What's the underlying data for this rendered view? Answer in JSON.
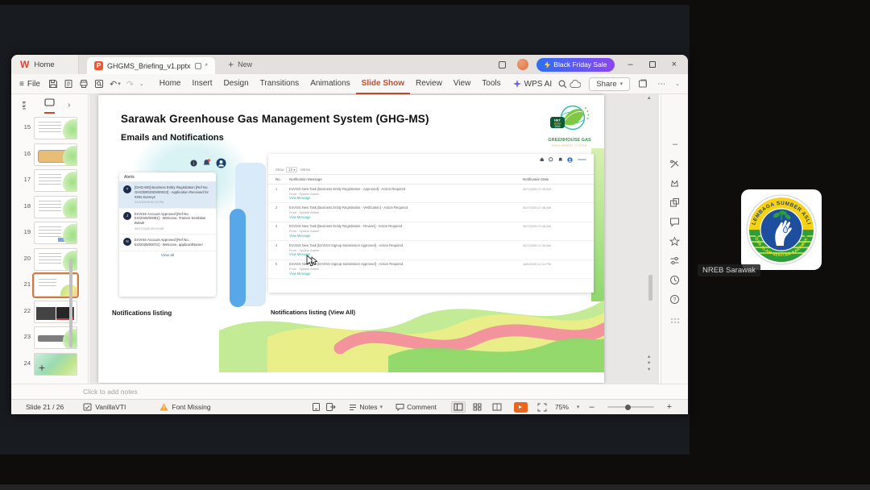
{
  "chrome": {
    "home_tab": "Home",
    "doc_tab": "GHGMS_Briefing_v1.pptx",
    "new_tab": "New",
    "promo": "Black Friday Sale",
    "file_menu": "File",
    "menus": [
      {
        "label": "Home",
        "cls": ""
      },
      {
        "label": "Insert",
        "cls": ""
      },
      {
        "label": "Design",
        "cls": ""
      },
      {
        "label": "Transitions",
        "cls": ""
      },
      {
        "label": "Animations",
        "cls": ""
      },
      {
        "label": "Slide Show",
        "cls": "active"
      },
      {
        "label": "Review",
        "cls": ""
      },
      {
        "label": "View",
        "cls": ""
      },
      {
        "label": "Tools",
        "cls": ""
      }
    ],
    "wps_ai": "WPS AI",
    "share": "Share"
  },
  "glyphs": {
    "wps_logo": "W",
    "doc_icon": "P",
    "asterisk": "*",
    "plus": "+",
    "menu": "≡",
    "undo": "↶",
    "redo": "↷",
    "caret_down": "▾",
    "chevron_down": "⌄",
    "chevron_right": "›",
    "more": "⋯",
    "minimize": "–",
    "close": "×",
    "scroll_up": "▴",
    "scroll_down": "▾",
    "minus": "–"
  },
  "sidebar": {
    "slides": [
      {
        "num": "15",
        "cls": "v-lines"
      },
      {
        "num": "16",
        "cls": "v-orange"
      },
      {
        "num": "17",
        "cls": "v-lines"
      },
      {
        "num": "18",
        "cls": "v-lines"
      },
      {
        "num": "19",
        "cls": "v-lines2"
      },
      {
        "num": "20",
        "cls": "v-lines"
      },
      {
        "num": "21",
        "cls": "v-current"
      },
      {
        "num": "22",
        "cls": "v-dark"
      },
      {
        "num": "23",
        "cls": "v-bar"
      },
      {
        "num": "24",
        "cls": "v-waves"
      }
    ]
  },
  "slide": {
    "title": "Sarawak Greenhouse Gas Management System (GHG-MS)",
    "subtitle": "Emails and Notifications",
    "logo": {
      "badge_line1": "NET",
      "badge_line2": "ZERO",
      "badge_line3": "2050",
      "name": "GREENHOUSE GAS",
      "tagline": "MANAGEMENT SYSTEM"
    },
    "alerts": {
      "header": "Alerts",
      "view_all": "View all",
      "items": [
        {
          "avatar": "T",
          "text": "[GHG-MS] Business Entity Registration [Ref No. GHG/BR/2025/00023] - Application Received for KNN Surveys",
          "date": "21/10/2025 02:19 PM",
          "highlight": "hl"
        },
        {
          "avatar": "J",
          "text": "EnVISS Account Approved [Ref No. ES/2025/00081] - Welcome, Trainee Sembilan Belad!",
          "date": "30/07/2025 09:09 AM",
          "highlight": ""
        },
        {
          "avatar": "N",
          "text": "EnVISS Account Approved [Ref No. ES/2025/00072] - Welcome, applicantName!",
          "date": "",
          "highlight": ""
        }
      ]
    },
    "table": {
      "show_prefix": "Show",
      "show_value": "10",
      "show_suffix": "entries",
      "col_no": "No.",
      "col_message": "Notification Message",
      "col_date": "Notification Date",
      "rows": [
        {
          "no": "1",
          "message": "EnVISS New Task [Business Entity Registration - Approved] - Action Required",
          "from": "From : System Admin",
          "link": "View Message",
          "date": "30/7/2025 07:49 AM"
        },
        {
          "no": "2",
          "message": "EnVISS New Task [Business Entity Registration - Verification] - Action Required",
          "from": "From : System Admin",
          "link": "View Message",
          "date": "30/7/2025 07:48 AM"
        },
        {
          "no": "3",
          "message": "EnVISS New Task [Business Entity Registration - Review] - Action Required",
          "from": "From : System Admin",
          "link": "View Message",
          "date": "30/7/2025 07:46 AM"
        },
        {
          "no": "4",
          "message": "EnVISS New Task [EnVISS Signup Submission Approved] - Action Required",
          "from": "From : System Admin",
          "link": "View Message",
          "date": "30/7/2025 07:30 AM"
        },
        {
          "no": "5",
          "message": "EnVISS New Task [EnVISS Signup Submission Approved] - Action Required",
          "from": "From : System Admin",
          "link": "View Message",
          "date": "16/6/2025 12:41 PM"
        }
      ]
    },
    "caption_left": "Notifications listing",
    "caption_right": "Notifications listing (View All)"
  },
  "notes": {
    "placeholder": "Click to add notes"
  },
  "statusbar": {
    "slide_indicator": "Slide 21 / 26",
    "theme_name": "VanillaVTI",
    "font_missing": "Font Missing",
    "notes_label": "Notes",
    "comment_label": "Comment",
    "zoom_level": "75%"
  },
  "participant": {
    "name": "NREB Sarawak",
    "logo_arc_top": "LEMBAGA SUMBER ASLI",
    "logo_arc_bottom": "DAN ALAM SEKITAR SARAWAK"
  },
  "colors": {
    "accent_orange": "#c14f2b",
    "promo_start": "#2e6ef2",
    "promo_end": "#8b45f2",
    "play_button": "#e8661d",
    "link_teal": "#2bb3a3",
    "link_blue": "#2e6bd6"
  }
}
